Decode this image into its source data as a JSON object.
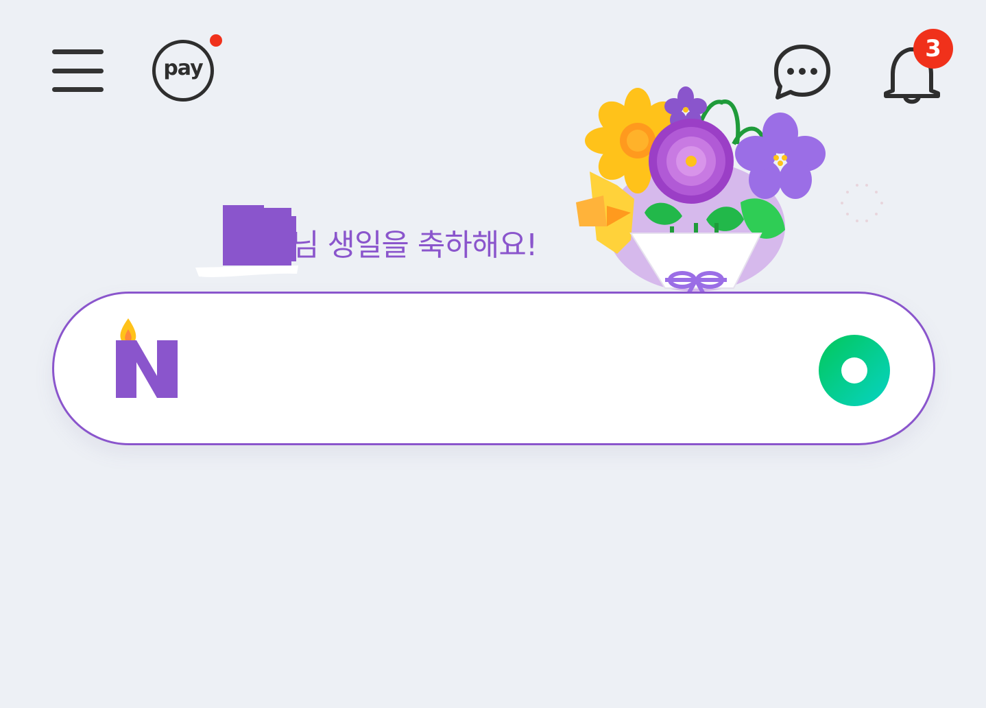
{
  "header": {
    "menu_icon": "hamburger-menu-icon",
    "pay_label": "pay",
    "pay_has_new_dot": true,
    "chat_icon": "chat-bubble-icon",
    "bell_icon": "bell-icon",
    "notification_count": "3"
  },
  "greeting": {
    "text": "님 생일을 축하해요!"
  },
  "search": {
    "logo_icon": "naver-birthday-n-logo-icon",
    "placeholder": "",
    "action_icon": "green-smart-lens-icon"
  },
  "colors": {
    "accent": "#8a55cc",
    "badge": "#f0311b",
    "background": "#edf0f5",
    "green": "#03cf5d"
  }
}
